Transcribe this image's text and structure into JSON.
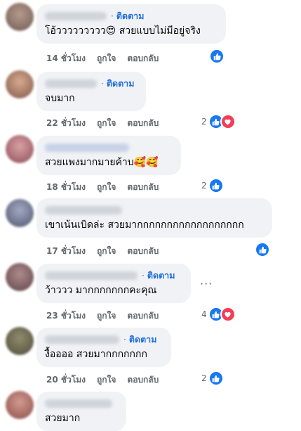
{
  "ui": {
    "follow": "ติดตาม",
    "dot": "·",
    "like": "ถูกใจ",
    "reply": "ตอบกลับ",
    "more": "···"
  },
  "comments": [
    {
      "text": "โอ้ววววววววว😍 สวยแบบไม่มีอยู่จริง",
      "time": "14 ชั่วโมง",
      "reaction_count": ""
    },
    {
      "text": "จบมาก",
      "time": "22 ชั่วโมง",
      "reaction_count": "2"
    },
    {
      "text": "สวยแพงมากมายค้าบ🥰🥰",
      "time": "18 ชั่วโมง",
      "reaction_count": "2"
    },
    {
      "text": "เขาเน้นเบิดล่ะ สวยมากกกกกกกกกกกกกกกกกก",
      "time": "17 ชั่วโมง",
      "reaction_count": ""
    },
    {
      "text": "ว้าววว มากกกกกกกคะคุณ",
      "time": "23 ชั่วโมง",
      "reaction_count": "4"
    },
    {
      "text": "งื้ออออ สวยมากกกกกกก",
      "time": "20 ชั่วโมง",
      "reaction_count": "2"
    },
    {
      "text": "สวยมาก",
      "time": "",
      "reaction_count": ""
    }
  ],
  "colors": {
    "bubble": "#f0f2f5",
    "follow": "#216fdb",
    "meta": "#65676b",
    "like": "#1877f2",
    "love": "#f33e58"
  },
  "icons": [
    "like-icon",
    "love-icon",
    "more-options-icon"
  ]
}
